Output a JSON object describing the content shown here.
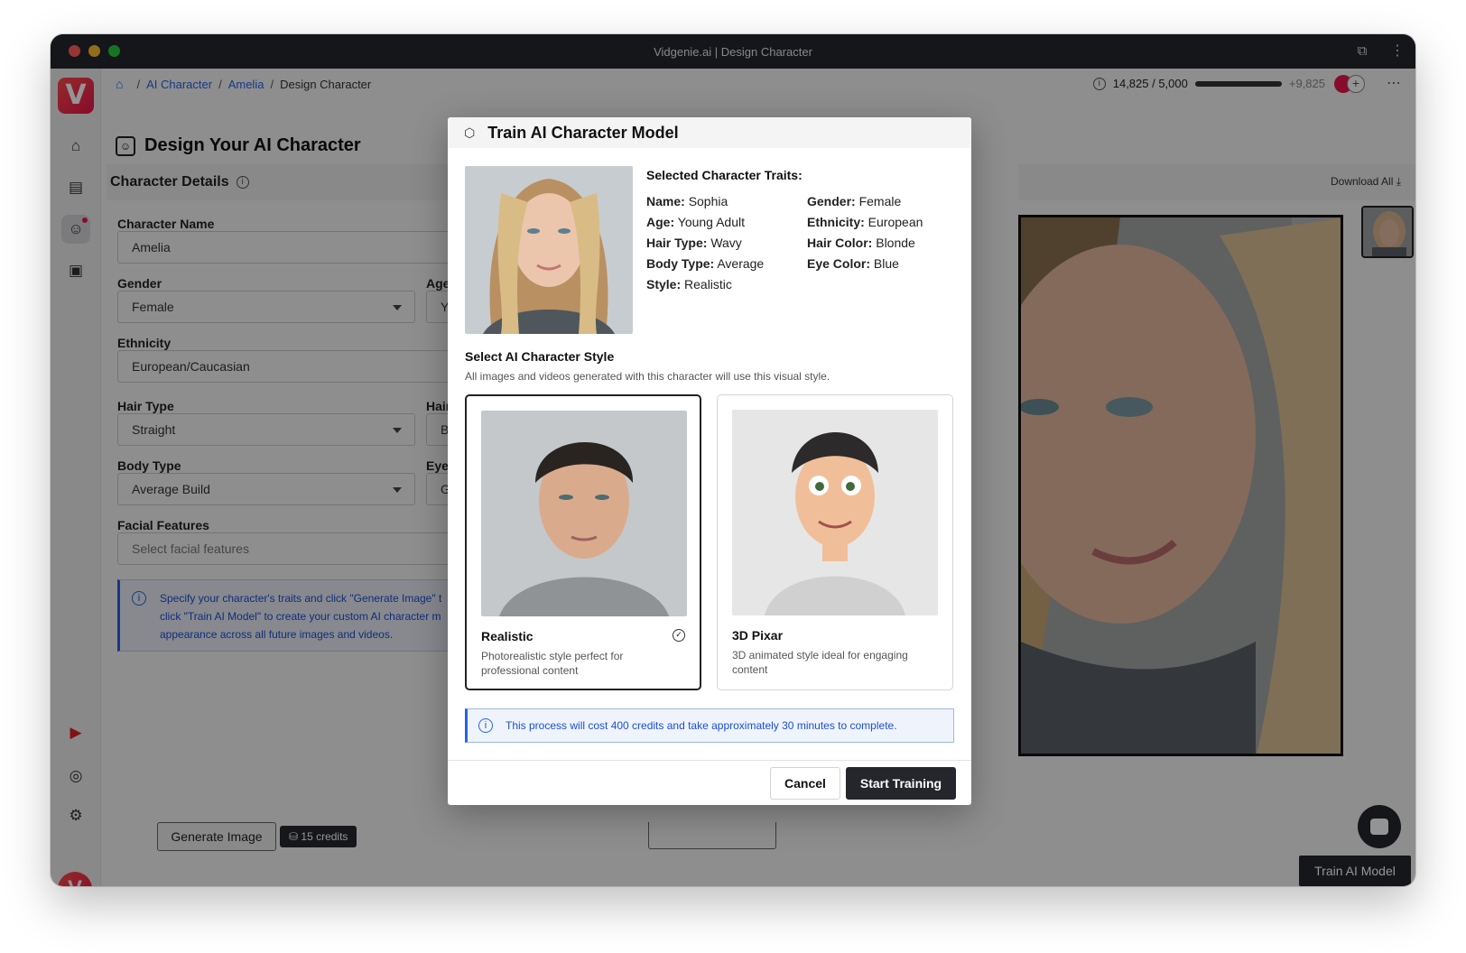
{
  "window": {
    "title": "Vidgenie.ai | Design Character"
  },
  "breadcrumb": {
    "items": [
      "AI Character",
      "Amelia",
      "Design Character"
    ]
  },
  "credits": {
    "used": "14,825 / 5,000",
    "extra": "+9,825"
  },
  "page": {
    "title": "Design Your AI Character"
  },
  "character_details": {
    "heading": "Character Details",
    "fields": {
      "name_label": "Character Name",
      "name_value": "Amelia",
      "gender_label": "Gender",
      "gender_value": "Female",
      "age_label": "Age",
      "age_value": "Yo",
      "ethnicity_label": "Ethnicity",
      "ethnicity_value": "European/Caucasian",
      "hair_type_label": "Hair Type",
      "hair_type_value": "Straight",
      "hair_color_label": "Hair",
      "hair_color_value": "Br",
      "body_type_label": "Body Type",
      "body_type_value": "Average Build",
      "eye_label": "Eye",
      "eye_value": "Gr",
      "facial_label": "Facial Features",
      "facial_placeholder": "Select facial features"
    },
    "hint_lines": [
      "Specify your character's traits and click \"Generate Image\" t",
      "click \"Train AI Model\" to create your custom AI character m",
      "appearance across all future images and videos."
    ],
    "generate_button": "Generate Image",
    "credit_cost": "15 credits"
  },
  "preview": {
    "download_all": "Download All",
    "train_button": "Train AI Model"
  },
  "modal": {
    "title": "Train AI Character Model",
    "traits_title": "Selected Character Traits:",
    "traits": [
      {
        "key": "Name:",
        "value": "Sophia"
      },
      {
        "key": "Gender:",
        "value": "Female"
      },
      {
        "key": "Age:",
        "value": "Young Adult"
      },
      {
        "key": "Ethnicity:",
        "value": "European"
      },
      {
        "key": "Hair Type:",
        "value": "Wavy"
      },
      {
        "key": "Hair Color:",
        "value": "Blonde"
      },
      {
        "key": "Body Type:",
        "value": "Average"
      },
      {
        "key": "Eye Color:",
        "value": "Blue"
      },
      {
        "key": "Style:",
        "value": "Realistic"
      }
    ],
    "style_title": "Select AI Character Style",
    "style_subtitle": "All images and videos generated with this character will use this visual style.",
    "styles": [
      {
        "name": "Realistic",
        "desc": "Photorealistic style perfect for professional content",
        "selected": true
      },
      {
        "name": "3D Pixar",
        "desc": "3D animated style ideal for engaging content",
        "selected": false
      }
    ],
    "cost_notice": "This process will cost 400 credits and take approximately 30 minutes to complete.",
    "cancel": "Cancel",
    "start": "Start Training"
  },
  "colors": {
    "accent": "#2563eb",
    "brand": "#e8154a",
    "dark": "#24262b"
  }
}
